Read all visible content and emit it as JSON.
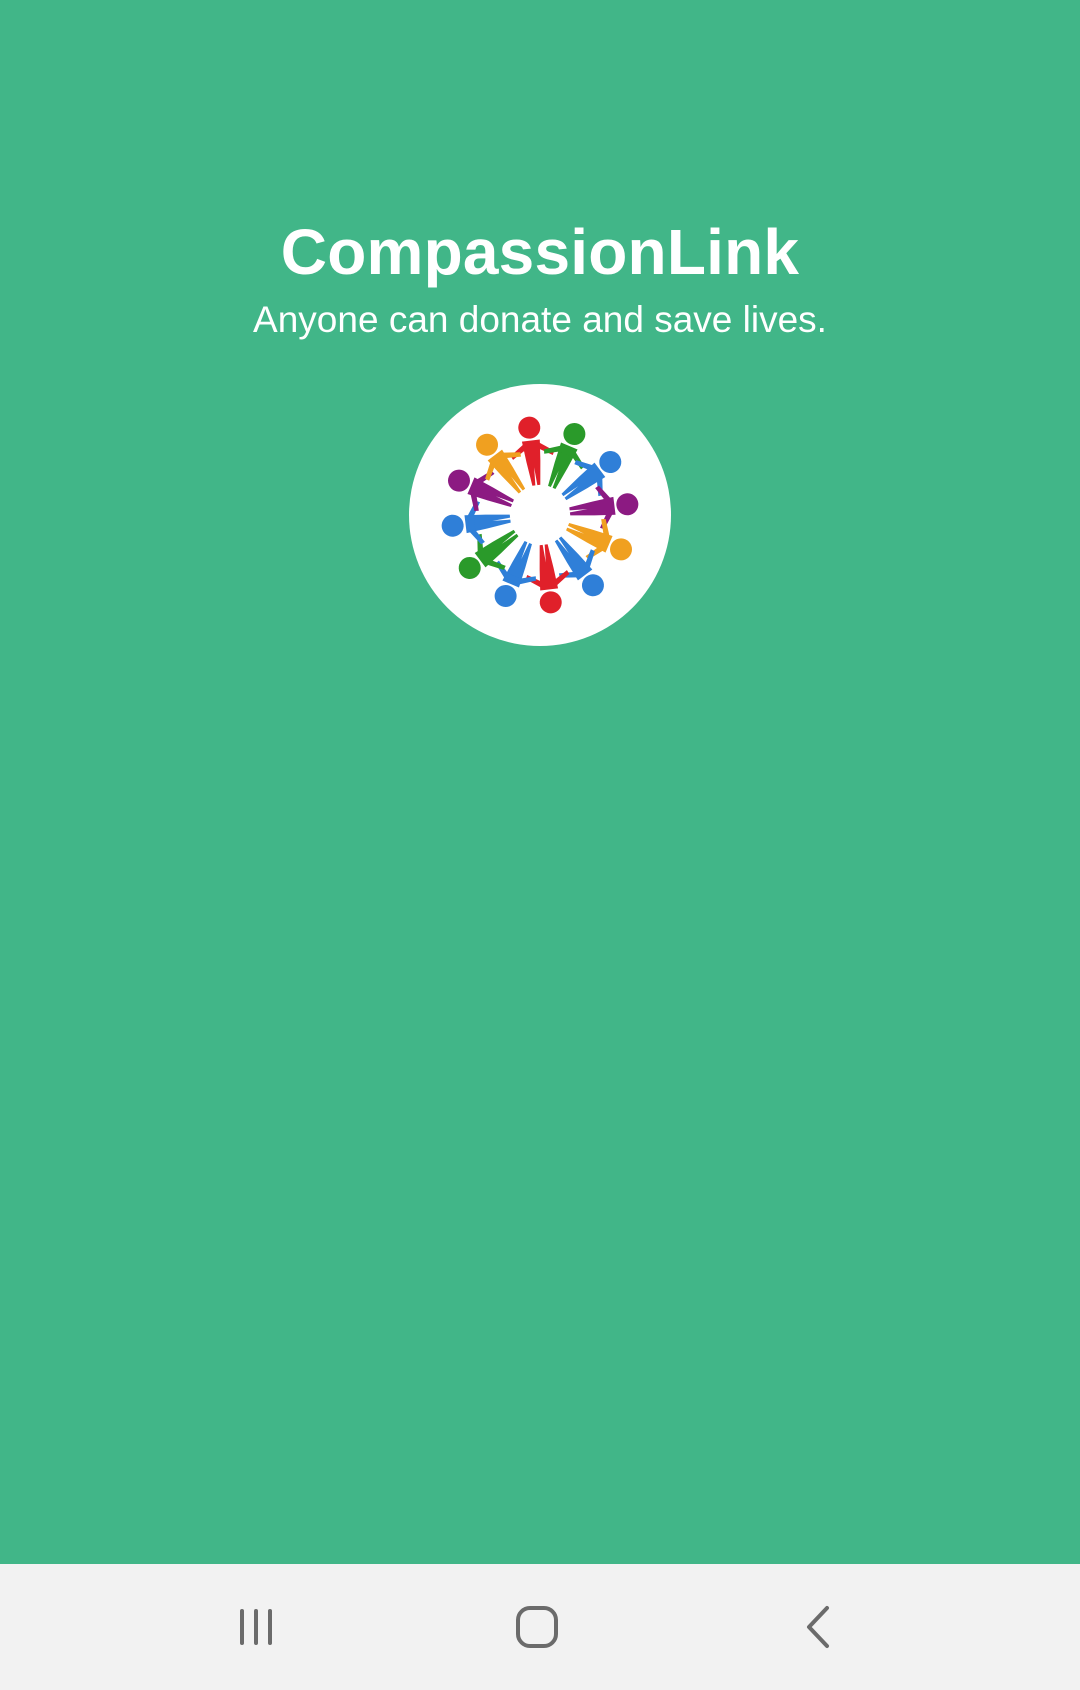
{
  "app": {
    "title": "CompassionLink",
    "tagline": "Anyone can donate and save lives."
  },
  "logo": {
    "icon": "people-circle-logo",
    "figure_colors": [
      "#e0202a",
      "#2a9a2a",
      "#2f7fd8",
      "#8c1a82",
      "#f0a020",
      "#2f7fd8",
      "#e0202a",
      "#2f7fd8",
      "#2a9a2a",
      "#2f7fd8",
      "#8c1a82",
      "#f0a020"
    ]
  },
  "colors": {
    "background": "#41b688",
    "navbar": "#f2f2f2",
    "nav_icon": "#6b6b6b"
  },
  "navbar": {
    "recent_icon": "recent-apps-icon",
    "home_icon": "home-icon",
    "back_icon": "back-icon"
  }
}
